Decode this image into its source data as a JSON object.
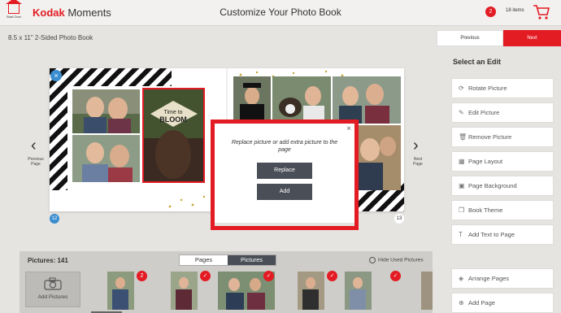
{
  "header": {
    "start_over_label": "Start Over",
    "brand_bold": "Kodak",
    "brand_light": " Moments",
    "page_title": "Customize Your Photo Book",
    "notification_count": "2",
    "cart_items": "18 items"
  },
  "book": {
    "title": "8.5 x 11\" 2-Sided Photo Book",
    "previous_label": "Previous",
    "next_label": "Next",
    "left_page_number": "12",
    "right_page_number": "13",
    "prev_page_label": "Previous Page",
    "next_page_label": "Next Page",
    "banner_text": "Time to BLOOM"
  },
  "dialog": {
    "message": "Replace picture or add extra picture to the page",
    "replace_label": "Replace",
    "add_label": "Add",
    "close_symbol": "×"
  },
  "sidebar": {
    "title": "Select an Edit",
    "items": [
      {
        "label": "Rotate Picture",
        "icon": "rotate-icon"
      },
      {
        "label": "Edit Picture",
        "icon": "edit-icon"
      },
      {
        "label": "Remove Picture",
        "icon": "trash-icon"
      },
      {
        "label": "Page Layout",
        "icon": "layout-icon"
      },
      {
        "label": "Page Background",
        "icon": "background-icon"
      },
      {
        "label": "Book Theme",
        "icon": "theme-icon"
      },
      {
        "label": "Add Text to Page",
        "icon": "text-icon"
      },
      {
        "label": "Arrange Pages",
        "icon": "arrange-icon"
      },
      {
        "label": "Add Page",
        "icon": "add-page-icon"
      }
    ]
  },
  "tray": {
    "pictures_count": "Pictures: 141",
    "tab_pages": "Pages",
    "tab_pictures": "Pictures",
    "hide_used": "Hide Used Pictures",
    "add_pictures": "Add Pictures",
    "thumb_badge_count": "2"
  },
  "colors": {
    "brand_red": "#e31b23",
    "page_badge_blue": "#3a8ed0",
    "dark_button": "#4a4e57"
  }
}
